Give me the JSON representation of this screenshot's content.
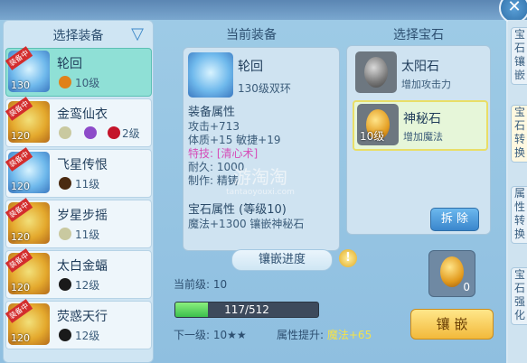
{
  "window": {
    "title": "",
    "close_symbol": "✕"
  },
  "right_tabs": [
    {
      "label": "宝\n石\n镶\n嵌"
    },
    {
      "label": "宝\n石\n转\n换"
    },
    {
      "label": "属\n性\n转\n换"
    },
    {
      "label": "宝\n石\n强\n化"
    }
  ],
  "left": {
    "title": "选择装备",
    "filter_icon": "funnel-icon",
    "items": [
      {
        "name": "轮回",
        "level": "130",
        "tag": "装备中",
        "gems": [
          {
            "color": "#e0811a",
            "text": "10级"
          }
        ],
        "selected": true
      },
      {
        "name": "金鸾仙衣",
        "level": "120",
        "tag": "装备中",
        "gems": [
          {
            "color": "#c9c9a0",
            "text": ""
          },
          {
            "color": "#8d4bc9",
            "text": ""
          },
          {
            "color": "#c4142a",
            "text": "2级"
          }
        ]
      },
      {
        "name": "飞星传恨",
        "level": "120",
        "tag": "装备中",
        "gems": [
          {
            "color": "#4a2a10",
            "text": "11级"
          }
        ]
      },
      {
        "name": "岁星步摇",
        "level": "120",
        "tag": "装备中",
        "gems": [
          {
            "color": "#c9c9a0",
            "text": "11级"
          }
        ]
      },
      {
        "name": "太白金蝠",
        "level": "120",
        "tag": "装备中",
        "gems": [
          {
            "color": "#1a1a1a",
            "text": "12级"
          }
        ]
      },
      {
        "name": "荧惑天行",
        "level": "120",
        "tag": "装备中",
        "gems": [
          {
            "color": "#1a1a1a",
            "text": "12级"
          }
        ]
      }
    ]
  },
  "current": {
    "title": "当前装备",
    "name": "轮回",
    "subtitle": "130级双环",
    "attr_header": "装备属性",
    "attrs": [
      "攻击+713",
      "体质+15 敏捷+19"
    ],
    "skill": "特技: [清心术]",
    "durability": "耐久: 1000",
    "maker": "制作: 精铸",
    "gem_header": "宝石属性 (等级10)",
    "gem_line": "魔法+1300 镶嵌神秘石"
  },
  "watermark": {
    "title": "游淘淘",
    "url": "tantaoyouxi.com"
  },
  "progress": {
    "label": "镶嵌进度",
    "current_level": "当前级: 10",
    "bar_text": "117/512",
    "value": 117,
    "max": 512,
    "next_level": "下一级: 10★★",
    "boost_label": "属性提升:",
    "boost_value": "魔法+65"
  },
  "gems": {
    "title": "选择宝石",
    "items": [
      {
        "name": "太阳石",
        "desc": "增加攻击力",
        "level": "",
        "color": "#777777",
        "selected": false
      },
      {
        "name": "神秘石",
        "desc": "增加魔法",
        "level": "10级",
        "color": "#e29a1d",
        "selected": true
      }
    ],
    "remove_label": "拆 除",
    "slot_count": "0",
    "inlay_label": "镶 嵌"
  }
}
